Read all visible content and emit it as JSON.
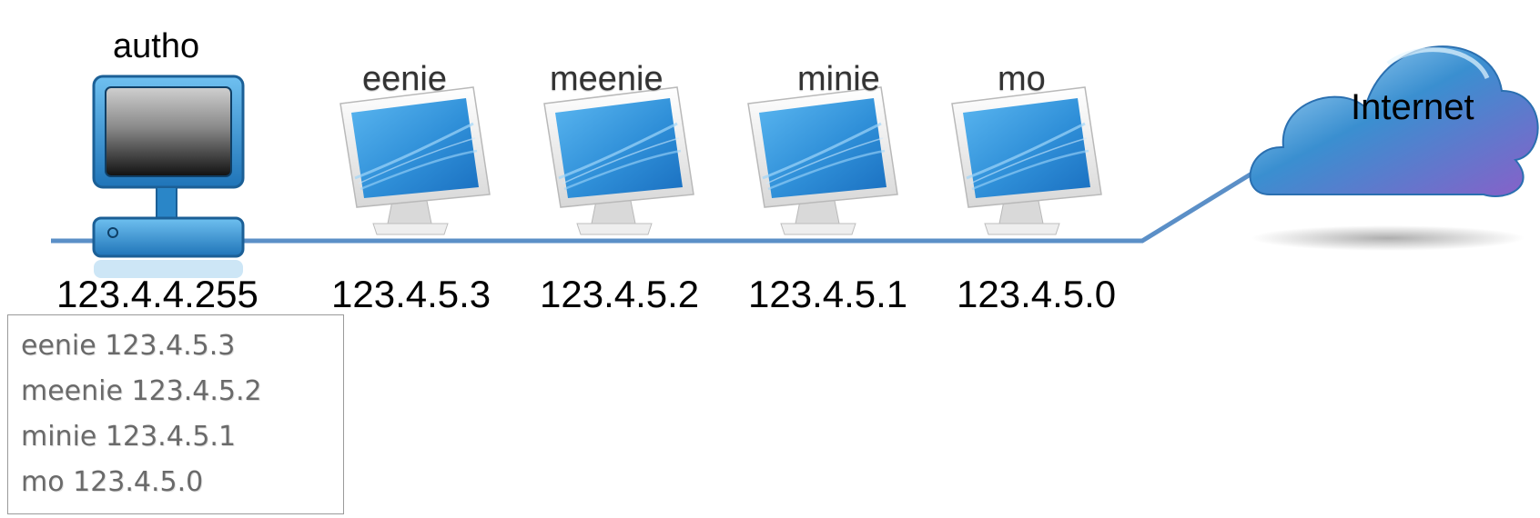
{
  "server": {
    "name": "autho",
    "ip": "123.4.4.255"
  },
  "clients": [
    {
      "name": "eenie",
      "ip": "123.4.5.3"
    },
    {
      "name": "meenie",
      "ip": "123.4.5.2"
    },
    {
      "name": "minie",
      "ip": "123.4.5.1"
    },
    {
      "name": "mo",
      "ip": "123.4.5.0"
    }
  ],
  "internet": {
    "label": "Internet",
    "icon": "cloud-icon"
  },
  "hosts_table": [
    "eenie 123.4.5.3",
    "meenie 123.4.5.2",
    "minie 123.4.5.1",
    "mo 123.4.5.0"
  ],
  "colors": {
    "network_line": "#5b8fc7",
    "screen_blue": "#2f8fd8",
    "server_blue": "#2a86c8",
    "cloud_blue": "#3a8fd0",
    "cloud_purple": "#8a5fc8"
  }
}
